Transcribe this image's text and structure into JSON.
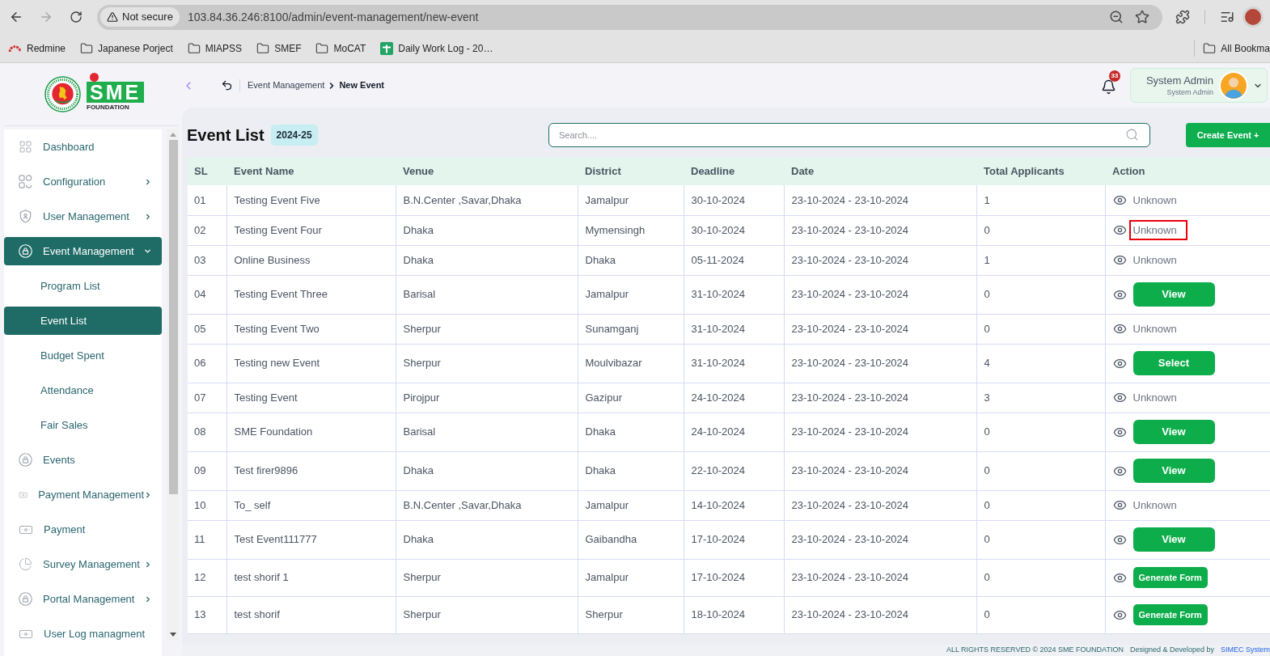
{
  "browser": {
    "forward_disabled": true,
    "security_chip": "Not secure",
    "url": "103.84.36.246:8100/admin/event-management/new-event",
    "bookmarks": [
      {
        "kind": "site",
        "label": "Redmine"
      },
      {
        "kind": "folder",
        "label": "Japanese Porject"
      },
      {
        "kind": "folder",
        "label": "MIAPSS"
      },
      {
        "kind": "folder",
        "label": "SMEF"
      },
      {
        "kind": "folder",
        "label": "MoCAT"
      },
      {
        "kind": "sheet",
        "label": "Daily Work Log - 20…"
      }
    ],
    "all_bookmarks": "All Bookma"
  },
  "logo": {
    "wordmark": "SME",
    "tagline": "FOUNDATION"
  },
  "sidebar": {
    "items": [
      {
        "label": "Dashboard",
        "selected": false
      },
      {
        "label": "Configuration",
        "selected": false,
        "expanded": false
      },
      {
        "label": "User Management",
        "selected": false,
        "expanded": false
      },
      {
        "label": "Event Management",
        "selected": true,
        "expanded": true,
        "children": [
          {
            "label": "Program List",
            "selected": false
          },
          {
            "label": "Event List",
            "selected": true
          },
          {
            "label": "Budget Spent",
            "selected": false
          },
          {
            "label": "Attendance",
            "selected": false
          },
          {
            "label": "Fair Sales",
            "selected": false
          }
        ]
      },
      {
        "label": "Events",
        "selected": false
      },
      {
        "label": "Payment Management",
        "selected": false,
        "expanded": false
      },
      {
        "label": "Payment",
        "selected": false
      },
      {
        "label": "Survey Management",
        "selected": false,
        "expanded": false
      },
      {
        "label": "Portal Management",
        "selected": false,
        "expanded": false
      },
      {
        "label": "User Log managment",
        "selected": false
      }
    ]
  },
  "header": {
    "breadcrumb": [
      {
        "label": "Event Management",
        "current": false
      },
      {
        "label": "New Event",
        "current": true
      }
    ],
    "notifications": "33",
    "user": {
      "name": "System Admin",
      "role": "System Admin"
    }
  },
  "page": {
    "title": "Event List",
    "year_badge": "2024-25",
    "search": {
      "placeholder": "Search...."
    },
    "create_button": "Create Event +"
  },
  "table": {
    "columns": [
      "SL",
      "Event Name",
      "Venue",
      "District",
      "Deadline",
      "Date",
      "Total Applicants",
      "Action"
    ],
    "rows": [
      {
        "cells": [
          "01",
          "Testing Event Five",
          "B.N.Center ,Savar,Dhaka",
          "Jamalpur",
          "30-10-2024",
          "23-10-2024 - 23-10-2024",
          "1"
        ],
        "action": {
          "kind": "text",
          "label": "Unknown",
          "highlighted": false
        }
      },
      {
        "cells": [
          "02",
          "Testing Event Four",
          "Dhaka",
          "Mymensingh",
          "30-10-2024",
          "23-10-2024 - 23-10-2024",
          "0"
        ],
        "action": {
          "kind": "text",
          "label": "Unknown",
          "highlighted": true
        }
      },
      {
        "cells": [
          "03",
          "Online Business",
          "Dhaka",
          "Dhaka",
          "05-11-2024",
          "23-10-2024 - 23-10-2024",
          "1"
        ],
        "action": {
          "kind": "text",
          "label": "Unknown",
          "highlighted": false
        }
      },
      {
        "cells": [
          "04",
          "Testing Event Three",
          "Barisal",
          "Jamalpur",
          "31-10-2024",
          "23-10-2024 - 23-10-2024",
          "0"
        ],
        "action": {
          "kind": "button",
          "label": "View",
          "highlighted": false
        }
      },
      {
        "cells": [
          "05",
          "Testing Event Two",
          "Sherpur",
          "Sunamganj",
          "31-10-2024",
          "23-10-2024 - 23-10-2024",
          "0"
        ],
        "action": {
          "kind": "text",
          "label": "Unknown",
          "highlighted": false
        }
      },
      {
        "cells": [
          "06",
          "Testing new Event",
          "Sherpur",
          "Moulvibazar",
          "31-10-2024",
          "23-10-2024 - 23-10-2024",
          "4"
        ],
        "action": {
          "kind": "button",
          "label": "Select",
          "highlighted": false
        }
      },
      {
        "cells": [
          "07",
          "Testing Event",
          "Pirojpur",
          "Gazipur",
          "24-10-2024",
          "23-10-2024 - 23-10-2024",
          "3"
        ],
        "action": {
          "kind": "text",
          "label": "Unknown",
          "highlighted": false
        }
      },
      {
        "cells": [
          "08",
          "SME Foundation",
          "Barisal",
          "Dhaka",
          "24-10-2024",
          "23-10-2024 - 23-10-2024",
          "0"
        ],
        "action": {
          "kind": "button",
          "label": "View",
          "highlighted": false
        }
      },
      {
        "cells": [
          "09",
          "Test firer9896",
          "Dhaka",
          "Dhaka",
          "22-10-2024",
          "23-10-2024 - 23-10-2024",
          "0"
        ],
        "action": {
          "kind": "button",
          "label": "View",
          "highlighted": false
        }
      },
      {
        "cells": [
          "10",
          "To_ self",
          "B.N.Center ,Savar,Dhaka",
          "Jamalpur",
          "14-10-2024",
          "23-10-2024 - 23-10-2024",
          "0"
        ],
        "action": {
          "kind": "text",
          "label": "Unknown",
          "highlighted": false
        }
      },
      {
        "cells": [
          "11",
          "Test Event111777",
          "Dhaka",
          "Gaibandha",
          "17-10-2024",
          "23-10-2024 - 23-10-2024",
          "0"
        ],
        "action": {
          "kind": "button",
          "label": "View",
          "highlighted": false
        }
      },
      {
        "cells": [
          "12",
          "test shorif 1",
          "Sherpur",
          "Jamalpur",
          "17-10-2024",
          "23-10-2024 - 23-10-2024",
          "0"
        ],
        "action": {
          "kind": "compact_button",
          "label": "Generate Form",
          "highlighted": false
        }
      },
      {
        "cells": [
          "13",
          "test shorif",
          "Sherpur",
          "Sherpur",
          "18-10-2024",
          "23-10-2024 - 23-10-2024",
          "0"
        ],
        "action": {
          "kind": "compact_button",
          "label": "Generate Form",
          "highlighted": false
        }
      }
    ]
  },
  "footer": {
    "copyright": "ALL RIGHTS RESERVED © 2024 SME FOUNDATION",
    "credit": "Designed & Developed by",
    "developer": "SIMEC System"
  }
}
